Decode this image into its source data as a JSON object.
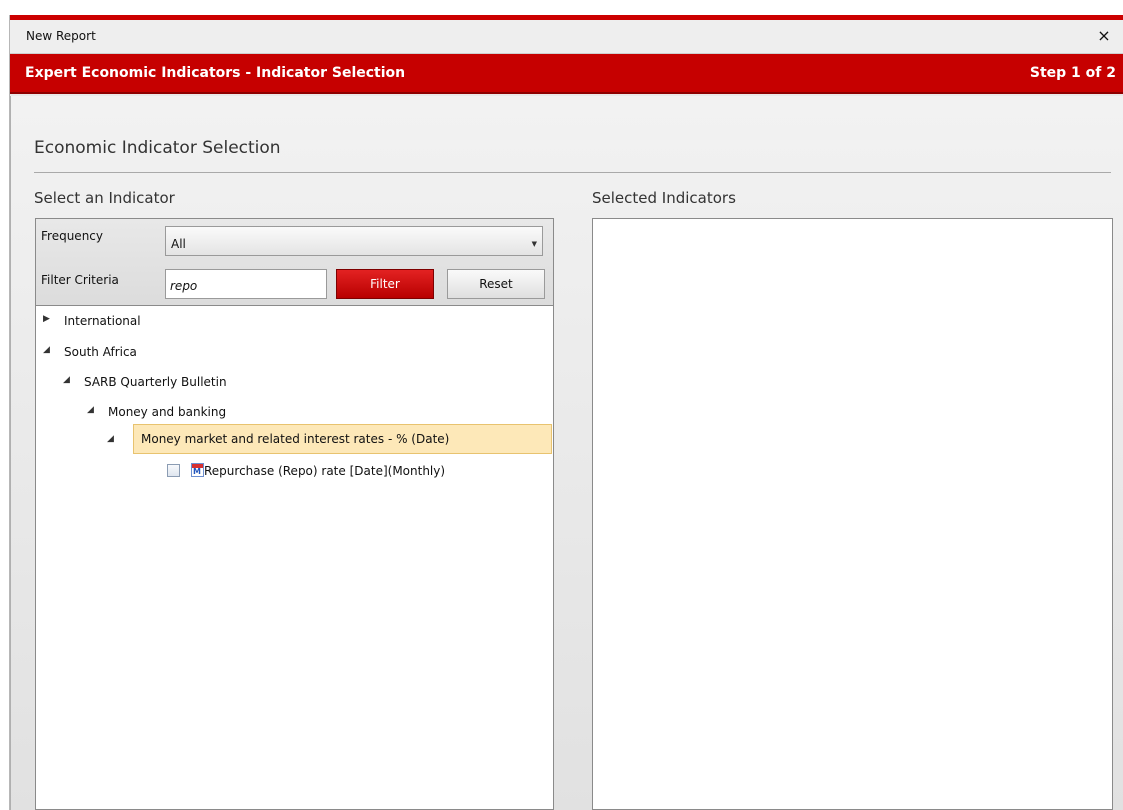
{
  "window": {
    "title": "New Report",
    "close_glyph": "×"
  },
  "banner": {
    "title": "Expert Economic Indicators - Indicator Selection",
    "step": "Step 1 of 2"
  },
  "section": {
    "heading": "Economic Indicator Selection"
  },
  "left_panel": {
    "title": "Select an Indicator",
    "frequency_label": "Frequency",
    "frequency_value": "All",
    "filter_label": "Filter Criteria",
    "filter_value": "repo",
    "filter_button": "Filter",
    "reset_button": "Reset"
  },
  "tree": [
    {
      "label": "International",
      "expanded": false,
      "level": 0
    },
    {
      "label": "South Africa",
      "expanded": true,
      "level": 0
    },
    {
      "label": "SARB Quarterly Bulletin",
      "expanded": true,
      "level": 1
    },
    {
      "label": "Money and banking",
      "expanded": true,
      "level": 2
    },
    {
      "label": "Money market and related interest rates - % (Date)",
      "expanded": true,
      "level": 3,
      "selected": true
    },
    {
      "label": "Repurchase (Repo) rate [Date](Monthly)",
      "level": 4,
      "checked": false,
      "icon": "calendar-monthly-icon",
      "icon_letter": "M"
    }
  ],
  "right_panel": {
    "title": "Selected Indicators"
  },
  "colors": {
    "brand_red": "#c60000",
    "highlight": "#fde8b8"
  }
}
